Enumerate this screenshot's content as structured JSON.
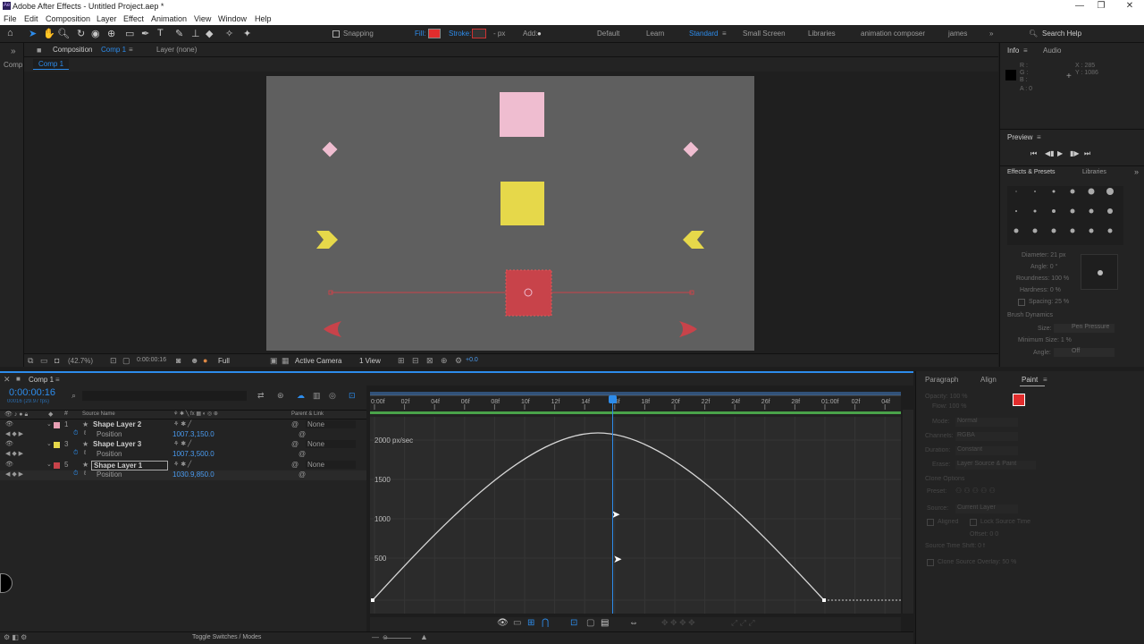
{
  "app": {
    "title": "Adobe After Effects - Untitled Project.aep *",
    "logo": "Ae",
    "window_controls": [
      "—",
      "❐",
      "✕"
    ]
  },
  "menu": [
    "File",
    "Edit",
    "Composition",
    "Layer",
    "Effect",
    "Animation",
    "View",
    "Window",
    "Help"
  ],
  "toolbar": {
    "snapping": "Snapping",
    "fill": "Fill:",
    "stroke": "Stroke:",
    "stroke_px": "- px",
    "add": "Add:",
    "workspaces": [
      "Default",
      "Learn",
      "Standard",
      "Small Screen",
      "Libraries",
      "animation composer",
      "james"
    ],
    "active_workspace": "Standard",
    "search_help": "Search Help"
  },
  "composition": {
    "panel_tab": "Composition",
    "comp_name": "Comp 1",
    "layer_tab": "Layer (none)",
    "subtab": "Comp 1",
    "left_label": "Comp"
  },
  "comp_footer": {
    "zoom": "(42.7%)",
    "timecode": "0:00:00:16",
    "resolution": "Full",
    "camera": "Active Camera",
    "views": "1 View",
    "exposure": "+0.0"
  },
  "info_panel": {
    "tab": "Info",
    "audio_tab": "Audio",
    "r": "R :",
    "g": "G :",
    "b": "B :",
    "a": "A : 0",
    "x": "X : 285",
    "y": "Y : 1086"
  },
  "preview": {
    "tab": "Preview"
  },
  "effects": {
    "tab": "Effects & Presets",
    "libraries": "Libraries",
    "diameter": "Diameter: 21 px",
    "angle": "Angle: 0 °",
    "roundness": "Roundness: 100 %",
    "hardness": "Hardness: 0 %",
    "spacing": "Spacing: 25 %",
    "brush_dynamics": "Brush Dynamics",
    "size": "Size:",
    "size_val": "Pen Pressure",
    "min_size": "Minimum Size: 1 %",
    "angle2": "Angle:",
    "angle2_val": "Off"
  },
  "timeline": {
    "tab": "Comp 1",
    "timecode": "0:00:00:16",
    "fps": "00016 (29.97 fps)",
    "col_source": "Source Name",
    "col_parent": "Parent & Link",
    "layers": [
      {
        "num": "1",
        "name": "Shape Layer 2",
        "color": "#e8a0b4",
        "prop": "Position",
        "value": "1007.3,150.0",
        "parent": "None"
      },
      {
        "num": "3",
        "name": "Shape Layer 3",
        "color": "#e6d84a",
        "prop": "Position",
        "value": "1007.3,500.0",
        "parent": "None"
      },
      {
        "num": "5",
        "name": "Shape Layer 1",
        "color": "#c8434a",
        "prop": "Position",
        "value": "1030.9,850.0",
        "parent": "None"
      }
    ],
    "ruler_ticks": [
      "0:00f",
      "02f",
      "04f",
      "06f",
      "08f",
      "10f",
      "12f",
      "14f",
      "16f",
      "18f",
      "20f",
      "22f",
      "24f",
      "26f",
      "28f",
      "01:00f",
      "02f",
      "04f"
    ],
    "graph_labels": [
      "2000 px/sec",
      "1500",
      "1000",
      "500"
    ],
    "toggle": "Toggle Switches / Modes"
  },
  "paint_panel": {
    "tabs": [
      "Paragraph",
      "Align",
      "Paint"
    ],
    "active": "Paint",
    "opacity": "Opacity: 100 %",
    "flow": "Flow: 100 %",
    "mode": "Mode:",
    "mode_val": "Normal",
    "channels": "Channels:",
    "channels_val": "RGBA",
    "duration": "Duration:",
    "duration_val": "Constant",
    "erase": "Erase:",
    "erase_val": "Layer Source & Paint",
    "clone_options": "Clone Options",
    "preset": "Preset:",
    "source": "Source:",
    "source_val": "Current Layer",
    "aligned": "Aligned",
    "lock_source": "Lock Source Time",
    "offset": "Offset: 0  0",
    "source_time_shift": "Source Time Shift: 0 f",
    "clone_overlay": "Clone Source Overlay: 50 %"
  },
  "colors": {
    "accent": "#2d8ceb",
    "fill": "#e22d2d",
    "pink": "#efbdd0",
    "yellow": "#e6d84a",
    "red": "#c8434a"
  }
}
